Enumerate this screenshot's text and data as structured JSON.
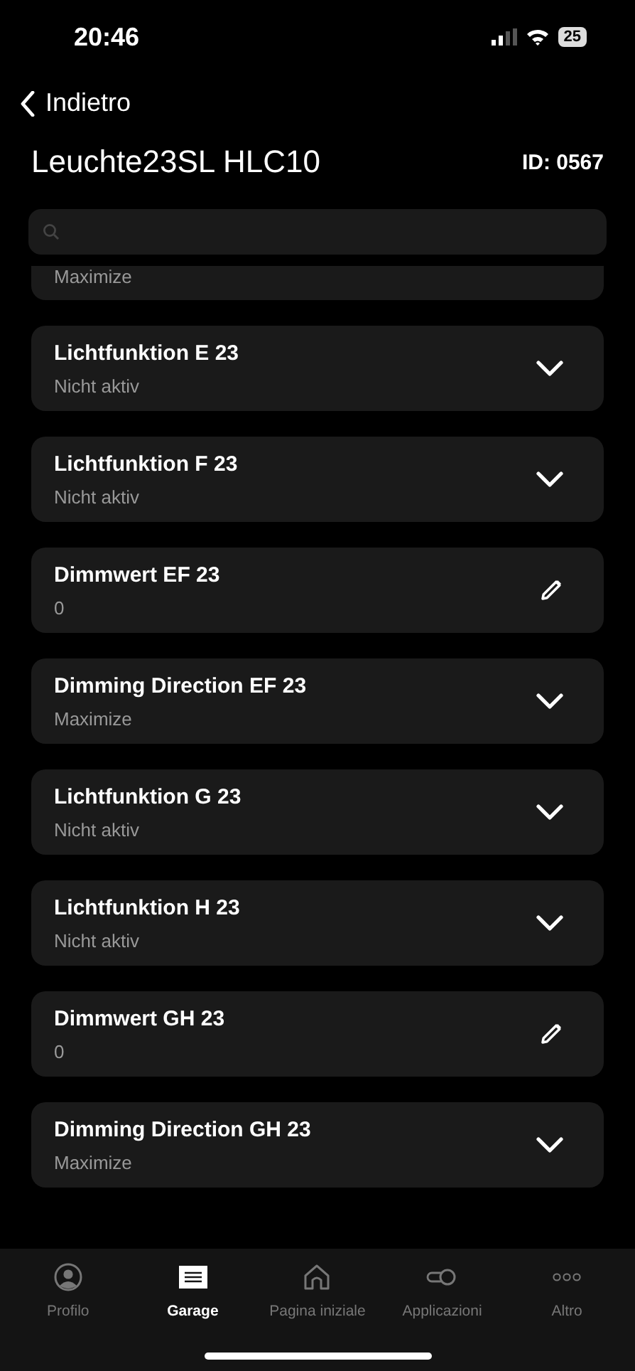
{
  "status_bar": {
    "time": "20:46",
    "battery": "25"
  },
  "nav": {
    "back": "Indietro"
  },
  "header": {
    "title": "Leuchte23SL HLC10",
    "id": "ID: 0567"
  },
  "partial_item": {
    "value": "Maximize"
  },
  "items": [
    {
      "kind": "select",
      "label": "Lichtfunktion E 23",
      "value": "Nicht aktiv"
    },
    {
      "kind": "select",
      "label": "Lichtfunktion F 23",
      "value": "Nicht aktiv"
    },
    {
      "kind": "edit",
      "label": "Dimmwert EF 23",
      "value": "0"
    },
    {
      "kind": "select",
      "label": "Dimming Direction EF 23",
      "value": "Maximize"
    },
    {
      "kind": "select",
      "label": "Lichtfunktion G 23",
      "value": "Nicht aktiv"
    },
    {
      "kind": "select",
      "label": "Lichtfunktion H 23",
      "value": "Nicht aktiv"
    },
    {
      "kind": "edit",
      "label": "Dimmwert GH 23",
      "value": "0"
    },
    {
      "kind": "select",
      "label": "Dimming Direction GH 23",
      "value": "Maximize"
    }
  ],
  "tab_bar": [
    {
      "kind": "profile",
      "label": "Profilo",
      "selected": false
    },
    {
      "kind": "garage",
      "label": "Garage",
      "selected": true
    },
    {
      "kind": "home",
      "label": "Pagina iniziale",
      "selected": false
    },
    {
      "kind": "apps",
      "label": "Applicazioni",
      "selected": false
    },
    {
      "kind": "more",
      "label": "Altro",
      "selected": false
    }
  ]
}
